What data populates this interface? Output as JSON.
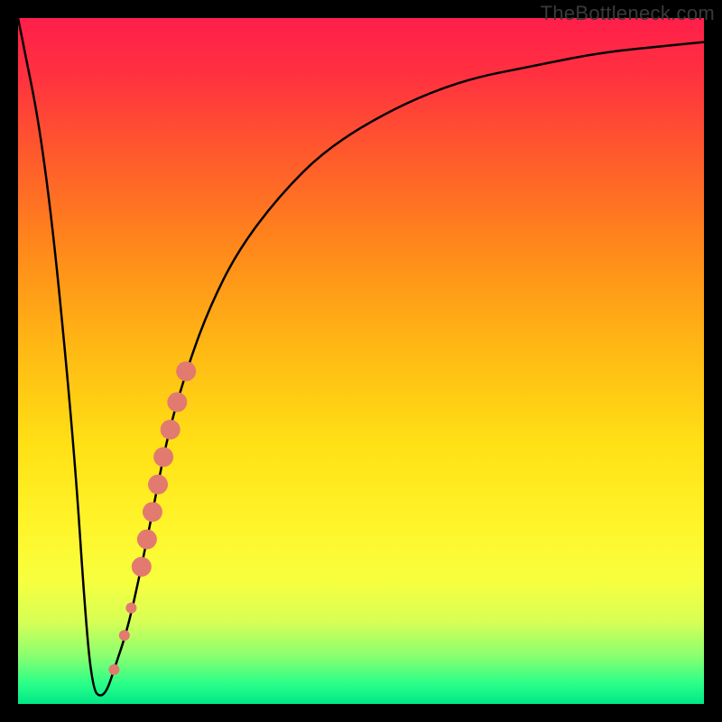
{
  "watermark": "TheBottleneck.com",
  "colors": {
    "background": "#000000",
    "curve": "#000000",
    "marker": "#e27a70",
    "gradient_top": "#ff1f4b",
    "gradient_bottom": "#00e886"
  },
  "chart_data": {
    "type": "line",
    "title": "",
    "xlabel": "",
    "ylabel": "",
    "ylim": [
      0,
      100
    ],
    "xlim": [
      0,
      100
    ],
    "series": [
      {
        "name": "bottleneck-curve",
        "x": [
          0,
          4,
          8,
          10,
          11,
          12,
          13,
          14,
          16,
          18,
          20,
          22,
          25,
          28,
          32,
          38,
          45,
          55,
          65,
          75,
          85,
          95,
          100
        ],
        "values": [
          100,
          80,
          40,
          10,
          2,
          1,
          2,
          5,
          11,
          20,
          30,
          40,
          50,
          58,
          66,
          74,
          81,
          87,
          91,
          93,
          95,
          96,
          96.5
        ]
      }
    ],
    "markers": [
      {
        "x": 14.0,
        "y": 5.0
      },
      {
        "x": 15.5,
        "y": 10.0
      },
      {
        "x": 16.5,
        "y": 14.0
      },
      {
        "x": 18.0,
        "y": 20.0
      },
      {
        "x": 18.8,
        "y": 24.0
      },
      {
        "x": 19.6,
        "y": 28.0
      },
      {
        "x": 20.4,
        "y": 32.0
      },
      {
        "x": 21.2,
        "y": 36.0
      },
      {
        "x": 22.2,
        "y": 40.0
      },
      {
        "x": 23.2,
        "y": 44.0
      },
      {
        "x": 24.5,
        "y": 48.5
      }
    ]
  }
}
